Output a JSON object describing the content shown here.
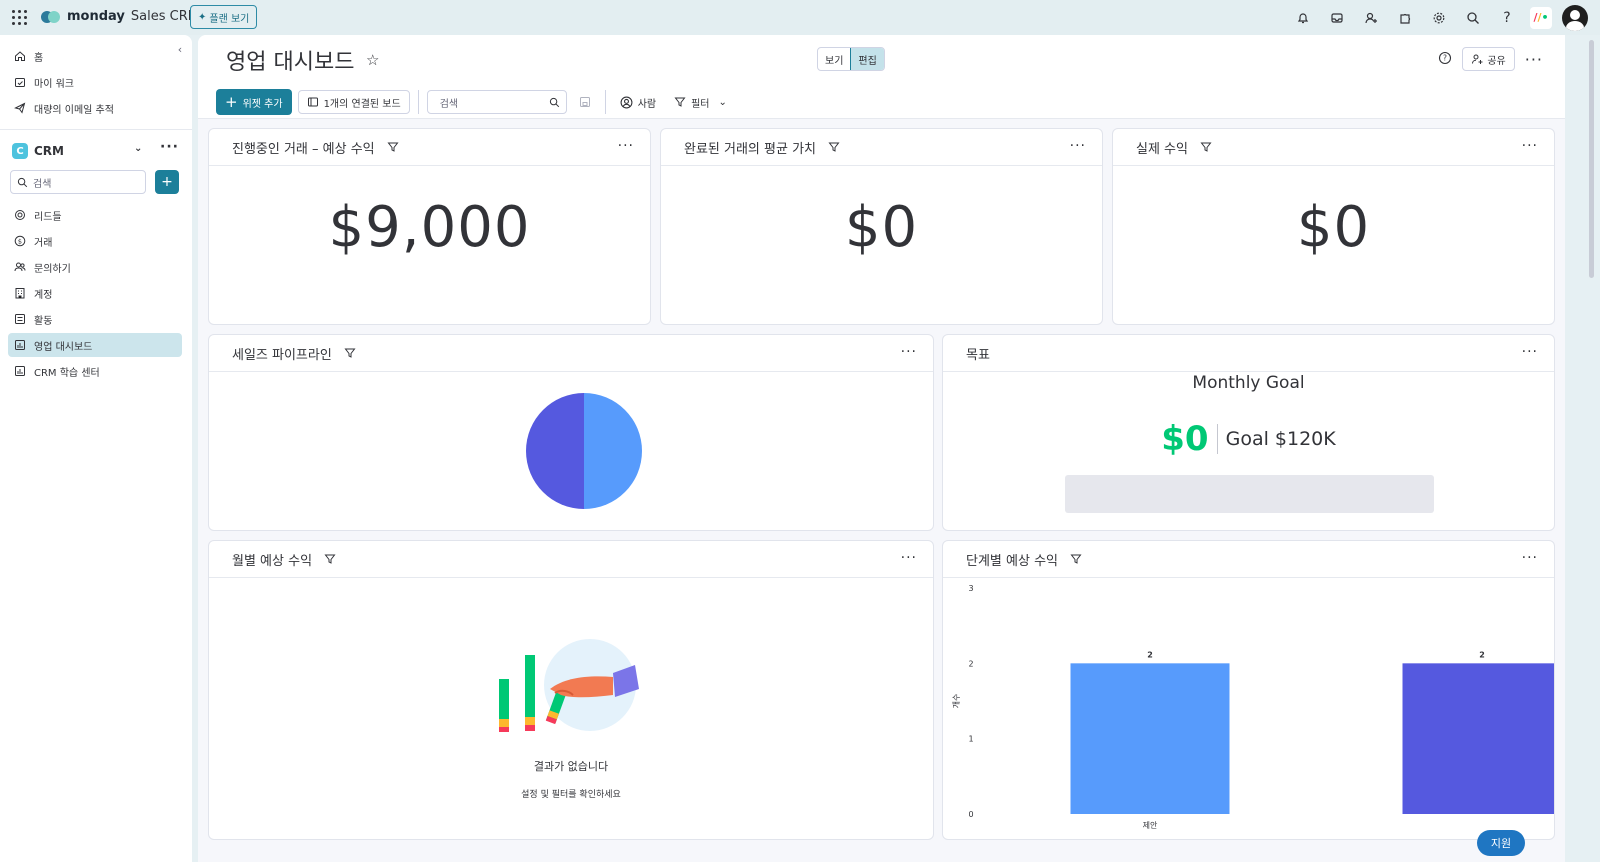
{
  "topbar": {
    "brand_bold": "monday",
    "brand_name": "Sales CRM",
    "plan_button": "플랜 보기"
  },
  "sidebar": {
    "nav": [
      {
        "label": "홈",
        "icon": "home-icon"
      },
      {
        "label": "마이 워크",
        "icon": "calendar-check-icon"
      },
      {
        "label": "대량의 이메일 추적",
        "icon": "send-icon"
      }
    ],
    "workspace": {
      "badge": "C",
      "name": "CRM"
    },
    "search_placeholder": "검색",
    "boards": [
      {
        "label": "리드들",
        "icon": "target-icon"
      },
      {
        "label": "거래",
        "icon": "dollar-icon"
      },
      {
        "label": "문의하기",
        "icon": "contacts-icon"
      },
      {
        "label": "계정",
        "icon": "building-icon"
      },
      {
        "label": "활동",
        "icon": "list-icon"
      },
      {
        "label": "영업 대시보드",
        "icon": "dashboard-icon",
        "active": true
      },
      {
        "label": "CRM 학습 센터",
        "icon": "dashboard-icon"
      }
    ]
  },
  "header": {
    "title": "영업 대시보드",
    "view_label": "보기",
    "edit_label": "편집",
    "share_label": "공유"
  },
  "toolbar": {
    "add_widget": "위젯 추가",
    "connected_boards": "1개의 연결된 보드",
    "search_placeholder": "검색",
    "person": "사람",
    "filter": "필터"
  },
  "widgets": {
    "open_deals": {
      "title": "진행중인 거래 – 예상 수익",
      "value": "$9,000"
    },
    "avg_closed": {
      "title": "완료된 거래의 평균 가치",
      "value": "$0"
    },
    "actual_revenue": {
      "title": "실제 수익",
      "value": "$0"
    },
    "pipeline": {
      "title": "세일즈 파이프라인"
    },
    "goal": {
      "title": "목표",
      "heading": "Monthly Goal",
      "value": "$0",
      "target": "Goal $120K"
    },
    "monthly": {
      "title": "월별 예상 수익",
      "empty_title": "결과가 없습니다",
      "empty_sub": "설정 및 필터를 확인하세요"
    },
    "by_stage": {
      "title": "단계별 예상 수익",
      "ylabel": "개수",
      "first_category": "제안"
    }
  },
  "chart_data": [
    {
      "type": "pie",
      "title": "세일즈 파이프라인",
      "values": [
        50,
        50
      ],
      "colors": [
        "#579bfc",
        "#5559df"
      ]
    },
    {
      "type": "bar",
      "title": "단계별 예상 수익",
      "ylabel": "개수",
      "categories": [
        "제안",
        ""
      ],
      "values": [
        2,
        2
      ],
      "ylim": [
        0,
        3
      ],
      "yticks": [
        0,
        1,
        2,
        3
      ],
      "colors": [
        "#579bfc",
        "#5559df"
      ]
    },
    {
      "type": "bar",
      "title": "Monthly Goal",
      "values": [
        0
      ],
      "target": 120000
    }
  ],
  "fab_label": "지원",
  "colors": {
    "primary": "#1c7f9a",
    "positive": "#00c875",
    "bar_blue": "#579bfc",
    "bar_purple": "#5559df"
  }
}
